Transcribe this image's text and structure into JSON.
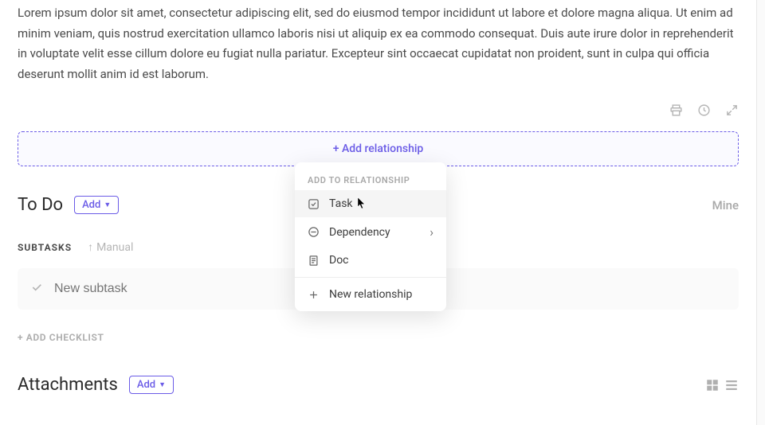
{
  "description": "Lorem ipsum dolor sit amet, consectetur adipiscing elit, sed do eiusmod tempor incididunt ut labore et dolore magna aliqua. Ut enim ad minim veniam, quis nostrud exercitation ullamco laboris nisi ut aliquip ex ea commodo consequat. Duis aute irure dolor in reprehenderit in voluptate velit esse cillum dolore eu fugiat nulla pariatur. Excepteur sint occaecat cupidatat non proident, sunt in culpa qui officia deserunt mollit anim id est laborum.",
  "relationship": {
    "add_label": "+ Add relationship"
  },
  "todo": {
    "title": "To Do",
    "add_label": "Add",
    "mine_label": "Mine"
  },
  "subtasks": {
    "label": "SUBTASKS",
    "sort": "Manual",
    "new_placeholder": "New subtask"
  },
  "checklist": {
    "add_label": "+ ADD CHECKLIST"
  },
  "attachments": {
    "title": "Attachments",
    "add_label": "Add"
  },
  "dropdown": {
    "header": "ADD TO RELATIONSHIP",
    "items": [
      {
        "label": "Task"
      },
      {
        "label": "Dependency"
      },
      {
        "label": "Doc"
      },
      {
        "label": "New relationship"
      }
    ]
  }
}
